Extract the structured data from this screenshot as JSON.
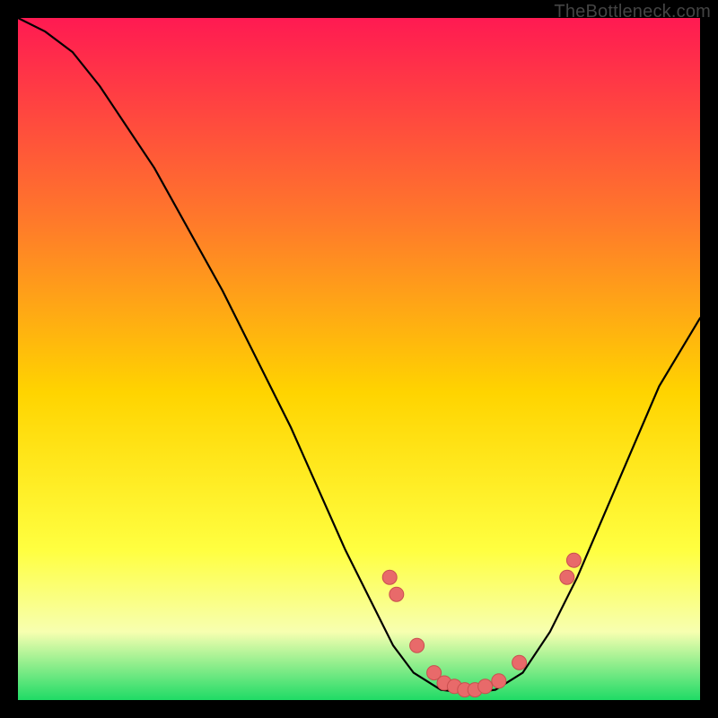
{
  "attribution": "TheBottleneck.com",
  "colors": {
    "frame": "#000000",
    "curve": "#000000",
    "marker_fill": "#e86a6a",
    "marker_stroke": "#c94f4f",
    "gradient_top": "#ff1a52",
    "gradient_mid1": "#ff7a2a",
    "gradient_mid2": "#ffd400",
    "gradient_mid3": "#ffff40",
    "gradient_band": "#f7ffb0",
    "gradient_bottom": "#1fdb66"
  },
  "chart_data": {
    "type": "line",
    "title": "",
    "xlabel": "",
    "ylabel": "",
    "xlim": [
      0,
      100
    ],
    "ylim": [
      0,
      100
    ],
    "grid": false,
    "legend": false,
    "curve": [
      {
        "x": 0,
        "y": 100
      },
      {
        "x": 4,
        "y": 98
      },
      {
        "x": 8,
        "y": 95
      },
      {
        "x": 12,
        "y": 90
      },
      {
        "x": 20,
        "y": 78
      },
      {
        "x": 30,
        "y": 60
      },
      {
        "x": 40,
        "y": 40
      },
      {
        "x": 48,
        "y": 22
      },
      {
        "x": 52,
        "y": 14
      },
      {
        "x": 55,
        "y": 8
      },
      {
        "x": 58,
        "y": 4
      },
      {
        "x": 62,
        "y": 1.5
      },
      {
        "x": 66,
        "y": 1
      },
      {
        "x": 70,
        "y": 1.5
      },
      {
        "x": 74,
        "y": 4
      },
      {
        "x": 78,
        "y": 10
      },
      {
        "x": 82,
        "y": 18
      },
      {
        "x": 88,
        "y": 32
      },
      {
        "x": 94,
        "y": 46
      },
      {
        "x": 100,
        "y": 56
      }
    ],
    "markers": [
      {
        "x": 54.5,
        "y": 18.0
      },
      {
        "x": 55.5,
        "y": 15.5
      },
      {
        "x": 58.5,
        "y": 8.0
      },
      {
        "x": 61.0,
        "y": 4.0
      },
      {
        "x": 62.5,
        "y": 2.5
      },
      {
        "x": 64.0,
        "y": 2.0
      },
      {
        "x": 65.5,
        "y": 1.5
      },
      {
        "x": 67.0,
        "y": 1.5
      },
      {
        "x": 68.5,
        "y": 2.0
      },
      {
        "x": 70.5,
        "y": 2.8
      },
      {
        "x": 73.5,
        "y": 5.5
      },
      {
        "x": 80.5,
        "y": 18.0
      },
      {
        "x": 81.5,
        "y": 20.5
      }
    ]
  }
}
